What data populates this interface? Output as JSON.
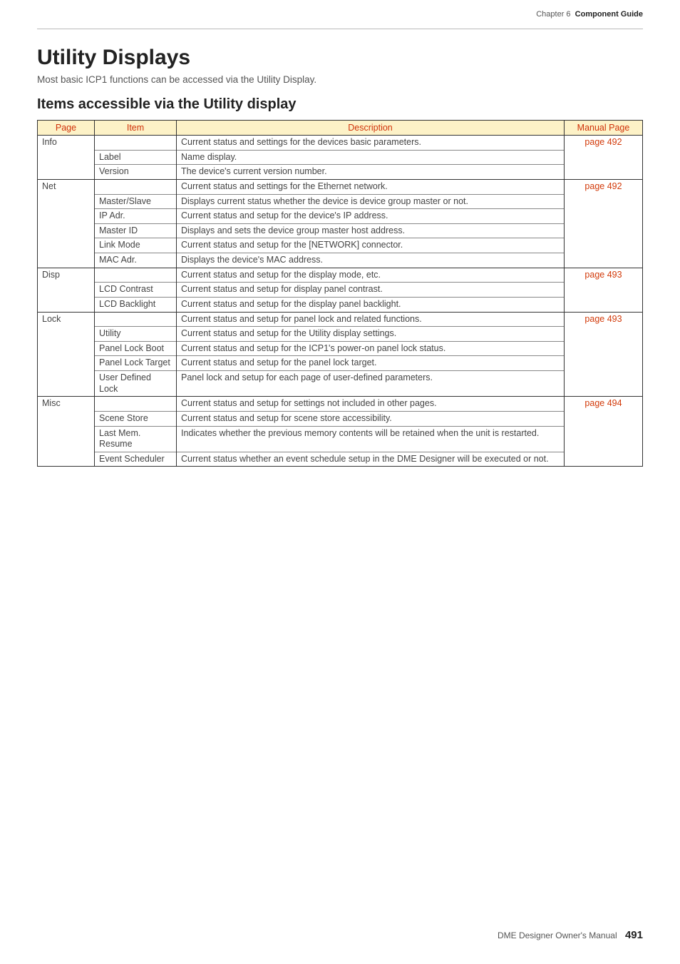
{
  "breadcrumb": {
    "chapter": "Chapter 6",
    "section": "Component Guide"
  },
  "title": "Utility Displays",
  "intro": "Most basic ICP1 functions can be accessed via the Utility Display.",
  "subheading": "Items accessible via the Utility display",
  "headers": {
    "page": "Page",
    "item": "Item",
    "desc": "Description",
    "manual": "Manual Page"
  },
  "groups": [
    {
      "page": "Info",
      "summary": "Current status and settings for the devices basic parameters.",
      "link": "page 492",
      "items": [
        {
          "item": "Label",
          "desc": "Name display."
        },
        {
          "item": "Version",
          "desc": "The device's current version number."
        }
      ]
    },
    {
      "page": "Net",
      "summary": "Current status and settings for the Ethernet network.",
      "link": "page 492",
      "items": [
        {
          "item": "Master/Slave",
          "desc": "Displays current status whether the device is device group master or not."
        },
        {
          "item": "IP Adr.",
          "desc": "Current status and setup for the device's IP address."
        },
        {
          "item": "Master ID",
          "desc": "Displays and sets the device group master host address."
        },
        {
          "item": "Link Mode",
          "desc": "Current status and setup for the [NETWORK] connector."
        },
        {
          "item": "MAC Adr.",
          "desc": "Displays the device's MAC address."
        }
      ]
    },
    {
      "page": "Disp",
      "summary": "Current status and setup for the display mode, etc.",
      "link": "page 493",
      "items": [
        {
          "item": "LCD Contrast",
          "desc": "Current status and setup for display panel contrast."
        },
        {
          "item": "LCD Backlight",
          "desc": "Current status and setup for the display panel backlight."
        }
      ]
    },
    {
      "page": "Lock",
      "summary": "Current status and setup for panel lock and related functions.",
      "link": "page 493",
      "items": [
        {
          "item": "Utility",
          "desc": "Current status and setup for the Utility display settings."
        },
        {
          "item": "Panel Lock Boot",
          "desc": "Current status and setup for the ICP1's power-on panel lock status."
        },
        {
          "item": "Panel Lock Target",
          "desc": "Current status and setup for the panel lock target."
        },
        {
          "item": "User Defined Lock",
          "desc": "Panel lock and setup for each page of user-defined parameters."
        }
      ]
    },
    {
      "page": "Misc",
      "summary": "Current status and setup for settings not included in other pages.",
      "link": "page 494",
      "items": [
        {
          "item": "Scene Store",
          "desc": "Current status and setup for scene store accessibility."
        },
        {
          "item": "Last Mem. Resume",
          "desc": "Indicates whether the previous memory contents will be retained when the unit is restarted."
        },
        {
          "item": "Event Scheduler",
          "desc": "Current status whether an event schedule setup in the DME Designer will be executed or not."
        }
      ]
    }
  ],
  "footer": {
    "text": "DME Designer Owner's Manual",
    "page_number": "491"
  }
}
